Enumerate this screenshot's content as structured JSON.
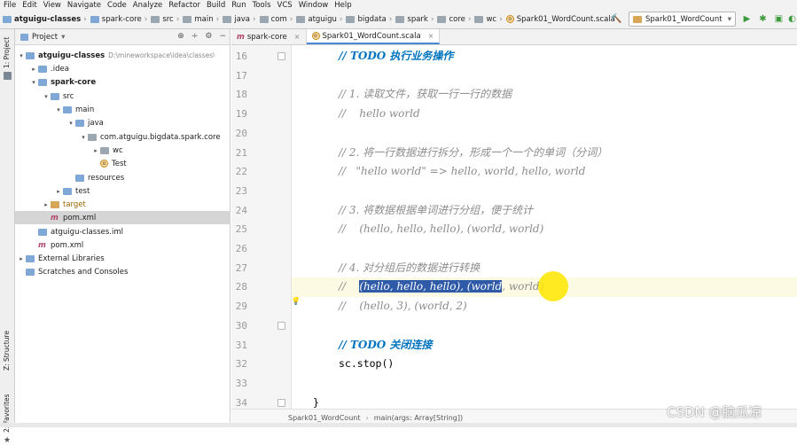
{
  "menu": [
    "File",
    "Edit",
    "View",
    "Navigate",
    "Code",
    "Analyze",
    "Refactor",
    "Build",
    "Run",
    "Tools",
    "VCS",
    "Window",
    "Help"
  ],
  "breadcrumbs": [
    "atguigu-classes",
    "spark-core",
    "src",
    "main",
    "java",
    "com",
    "atguigu",
    "bigdata",
    "spark",
    "core",
    "wc",
    "Spark01_WordCount.scala"
  ],
  "run_config": "Spark01_WordCount",
  "side_tabs": {
    "project": "1: Project",
    "structure": "Z: Structure",
    "favorites": "2: Favorites"
  },
  "project_panel": {
    "title": "Project",
    "tree": [
      {
        "label": "atguigu-classes",
        "path": "D:\\mineworkspace\\idea\\classes\\a",
        "arrow": "▾",
        "bold": true
      },
      {
        "label": ".idea",
        "arrow": "▸"
      },
      {
        "label": "spark-core",
        "arrow": "▾",
        "bold": true
      },
      {
        "label": "src",
        "arrow": "▾"
      },
      {
        "label": "main",
        "arrow": "▾"
      },
      {
        "label": "java",
        "arrow": "▾"
      },
      {
        "label": "com.atguigu.bigdata.spark.core",
        "arrow": "▾"
      },
      {
        "label": "wc",
        "arrow": "▸"
      },
      {
        "label": "Test",
        "arrow": ""
      },
      {
        "label": "resources",
        "arrow": ""
      },
      {
        "label": "test",
        "arrow": "▸"
      },
      {
        "label": "target",
        "arrow": "▸"
      },
      {
        "label": "pom.xml",
        "arrow": ""
      },
      {
        "label": "atguigu-classes.iml",
        "arrow": ""
      },
      {
        "label": "pom.xml",
        "arrow": ""
      },
      {
        "label": "External Libraries",
        "arrow": "▸"
      },
      {
        "label": "Scratches and Consoles",
        "arrow": ""
      }
    ]
  },
  "editor": {
    "tabs": [
      {
        "label": "spark-core",
        "active": false
      },
      {
        "label": "Spark01_WordCount.scala",
        "active": true
      }
    ],
    "lines": [
      {
        "n": "16",
        "text": "// TODO 执行业务操作",
        "kind": "todo"
      },
      {
        "n": "17",
        "text": "",
        "kind": "plain"
      },
      {
        "n": "18",
        "text": "// 1. 读取文件，获取一行一行的数据",
        "kind": "cmt"
      },
      {
        "n": "19",
        "text": "//    hello world",
        "kind": "cmt"
      },
      {
        "n": "20",
        "text": "",
        "kind": "plain"
      },
      {
        "n": "21",
        "text": "// 2. 将一行数据进行拆分，形成一个一个的单词（分词）",
        "kind": "cmt"
      },
      {
        "n": "22",
        "text": "//   \"hello world\" => hello, world, hello, world",
        "kind": "cmt"
      },
      {
        "n": "23",
        "text": "",
        "kind": "plain"
      },
      {
        "n": "24",
        "text": "// 3. 将数据根据单词进行分组，便于统计",
        "kind": "cmt"
      },
      {
        "n": "25",
        "text": "//    (hello, hello, hello), (world, world)",
        "kind": "cmt"
      },
      {
        "n": "26",
        "text": "",
        "kind": "plain"
      },
      {
        "n": "27",
        "text": "// 4. 对分组后的数据进行转换",
        "kind": "cmt"
      },
      {
        "n": "28",
        "text": "//    ",
        "kind": "cmt",
        "sel": "(hello, hello, hello), (world",
        "rest": ", world)"
      },
      {
        "n": "29",
        "text": "//    (hello, 3), (world, 2)",
        "kind": "cmt"
      },
      {
        "n": "30",
        "text": "",
        "kind": "plain"
      },
      {
        "n": "31",
        "text": "// TODO 关闭连接",
        "kind": "todo"
      },
      {
        "n": "32",
        "text": "sc.stop()",
        "kind": "plain"
      },
      {
        "n": "33",
        "text": "",
        "kind": "plain"
      },
      {
        "n": "34",
        "text": "}",
        "kind": "plain"
      }
    ],
    "breadcrumb": [
      "Spark01_WordCount",
      "main(args: Array[String])"
    ]
  },
  "watermark": "CSDN @脑瓜凉"
}
